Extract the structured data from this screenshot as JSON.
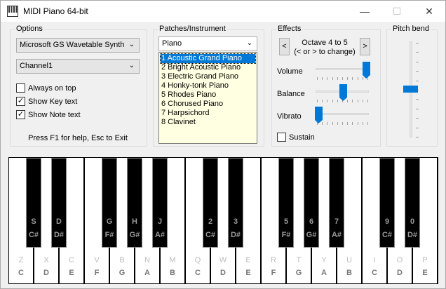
{
  "window": {
    "title": "MIDI Piano 64-bit"
  },
  "options": {
    "title": "Options",
    "device": "Microsoft GS Wavetable Synth",
    "channel": "Channel1",
    "always_on_top": {
      "label": "Always on top",
      "checked": false
    },
    "show_key_text": {
      "label": "Show Key text",
      "checked": true
    },
    "show_note_text": {
      "label": "Show Note text",
      "checked": true
    },
    "help_text": "Press F1 for help, Esc to Exit"
  },
  "patches": {
    "title": "Patches/Instrument",
    "group": "Piano",
    "items": [
      "1 Acoustic Grand Piano",
      "2 Bright Acoustic Piano",
      "3 Electric Grand Piano",
      "4 Honky-tonk Piano",
      "5 Rhodes Piano",
      "6 Chorused Piano",
      "7 Harpsichord",
      "8 Clavinet"
    ],
    "selected_index": 0
  },
  "effects": {
    "title": "Effects",
    "octave_line1": "Octave 4 to 5",
    "octave_line2": "(< or > to change)",
    "prev": "<",
    "next": ">",
    "volume_label": "Volume",
    "volume_level": 1.0,
    "balance_label": "Balance",
    "balance_level": 0.5,
    "vibrato_label": "Vibrato",
    "vibrato_level": 0.0,
    "sustain": {
      "label": "Sustain",
      "checked": false
    }
  },
  "pitch_bend": {
    "title": "Pitch bend",
    "level": 0.5
  },
  "keyboard": {
    "white_keys": [
      {
        "key": "Z",
        "note": "C"
      },
      {
        "key": "X",
        "note": "D"
      },
      {
        "key": "C",
        "note": "E"
      },
      {
        "key": "V",
        "note": "F"
      },
      {
        "key": "B",
        "note": "G"
      },
      {
        "key": "N",
        "note": "A"
      },
      {
        "key": "M",
        "note": "B"
      },
      {
        "key": "Q",
        "note": "C"
      },
      {
        "key": "W",
        "note": "D"
      },
      {
        "key": "E",
        "note": "E"
      },
      {
        "key": "R",
        "note": "F"
      },
      {
        "key": "T",
        "note": "G"
      },
      {
        "key": "Y",
        "note": "A"
      },
      {
        "key": "U",
        "note": "B"
      },
      {
        "key": "I",
        "note": "C"
      },
      {
        "key": "O",
        "note": "D"
      },
      {
        "key": "P",
        "note": "E"
      }
    ],
    "black_keys": [
      {
        "key": "S",
        "note": "C#"
      },
      {
        "key": "D",
        "note": "D#"
      },
      {
        "key": "G",
        "note": "F#"
      },
      {
        "key": "H",
        "note": "G#"
      },
      {
        "key": "J",
        "note": "A#"
      },
      {
        "key": "2",
        "note": "C#"
      },
      {
        "key": "3",
        "note": "D#"
      },
      {
        "key": "5",
        "note": "F#"
      },
      {
        "key": "6",
        "note": "G#"
      },
      {
        "key": "7",
        "note": "A#"
      },
      {
        "key": "9",
        "note": "C#"
      },
      {
        "key": "0",
        "note": "D#"
      }
    ]
  },
  "colors": {
    "accent": "#0078d7",
    "list_bg": "#ffffe1"
  }
}
